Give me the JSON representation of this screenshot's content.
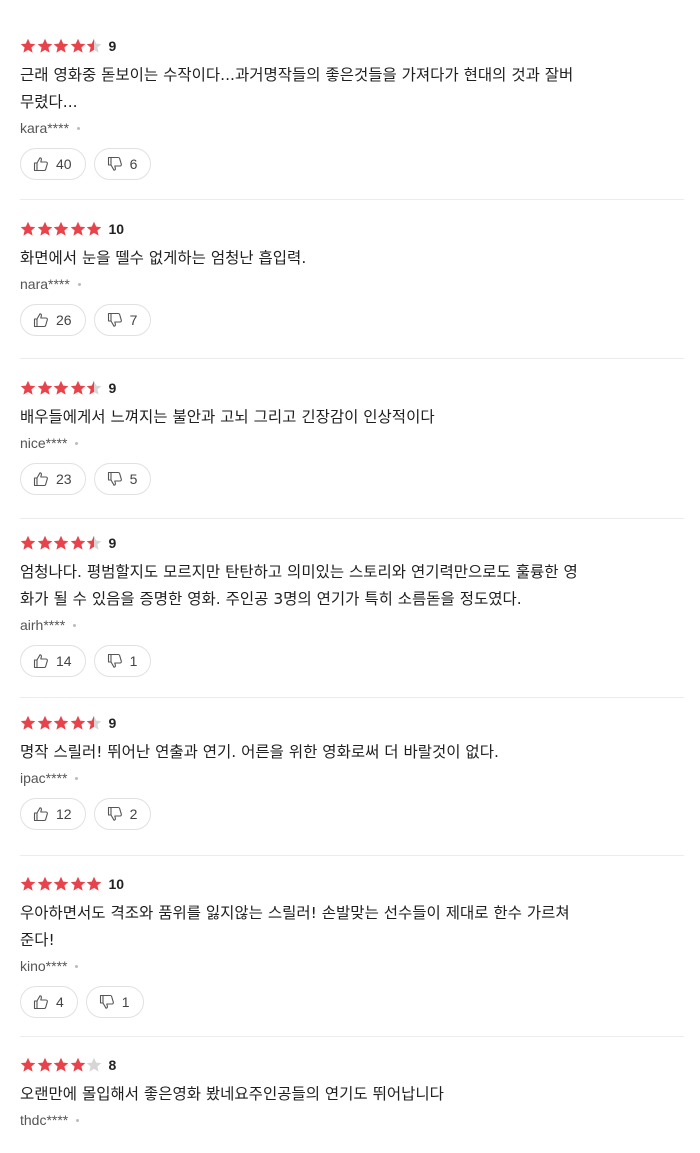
{
  "colors": {
    "star_filled": "#e8424b",
    "star_empty": "#d6d6d6",
    "divider": "#ececec"
  },
  "reviews": [
    {
      "stars": 4.5,
      "score": "9",
      "lines": [
        "근래 영화중 돋보이는 수작이다...과거명작들의 좋은것들을 가져다가 현대의 것과 잘버",
        "무렸다..."
      ],
      "user": "kara****",
      "likes": "40",
      "dislikes": "6"
    },
    {
      "stars": 5,
      "score": "10",
      "lines": [
        "화면에서 눈을 뗄수 없게하는 엄청난 흡입력."
      ],
      "user": "nara****",
      "likes": "26",
      "dislikes": "7"
    },
    {
      "stars": 4.5,
      "score": "9",
      "lines": [
        "배우들에게서 느껴지는 불안과 고뇌 그리고 긴장감이 인상적이다"
      ],
      "user": "nice****",
      "likes": "23",
      "dislikes": "5"
    },
    {
      "stars": 4.5,
      "score": "9",
      "lines": [
        "엄청나다. 평범할지도 모르지만 탄탄하고 의미있는 스토리와 연기력만으로도 훌륭한 영",
        "화가 될 수 있음을 증명한 영화. 주인공 3명의 연기가 특히 소름돋을 정도였다."
      ],
      "user": "airh****",
      "likes": "14",
      "dislikes": "1"
    },
    {
      "stars": 4.5,
      "score": "9",
      "lines": [
        "명작 스릴러! 뛰어난 연출과 연기. 어른을 위한 영화로써 더 바랄것이 없다."
      ],
      "user": "ipac****",
      "likes": "12",
      "dislikes": "2"
    },
    {
      "stars": 5,
      "score": "10",
      "lines": [
        "우아하면서도 격조와 품위를 잃지않는 스릴러! 손발맞는 선수들이 제대로 한수 가르쳐",
        "준다!"
      ],
      "user": "kino****",
      "likes": "4",
      "dislikes": "1"
    },
    {
      "stars": 4,
      "score": "8",
      "lines": [
        "오랜만에 몰입해서 좋은영화 봤네요주인공들의 연기도 뛰어납니다"
      ],
      "user": "thdc****"
    }
  ]
}
